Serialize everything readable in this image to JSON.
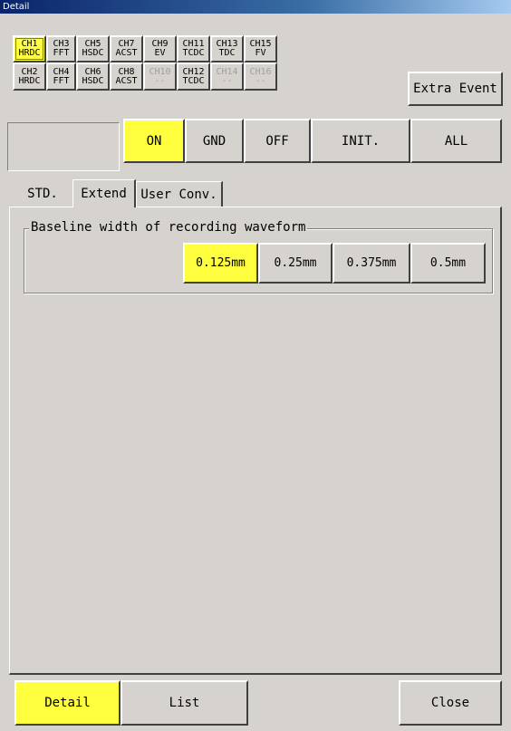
{
  "window": {
    "title": "Detail"
  },
  "channels_row1": [
    {
      "ch": "CH1",
      "type": "HRDC"
    },
    {
      "ch": "CH3",
      "type": "FFT"
    },
    {
      "ch": "CH5",
      "type": "HSDC"
    },
    {
      "ch": "CH7",
      "type": "ACST"
    },
    {
      "ch": "CH9",
      "type": "EV"
    },
    {
      "ch": "CH11",
      "type": "TCDC"
    },
    {
      "ch": "CH13",
      "type": "TDC"
    },
    {
      "ch": "CH15",
      "type": "FV"
    }
  ],
  "channels_row2": [
    {
      "ch": "CH2",
      "type": "HRDC"
    },
    {
      "ch": "CH4",
      "type": "FFT"
    },
    {
      "ch": "CH6",
      "type": "HSDC"
    },
    {
      "ch": "CH8",
      "type": "ACST"
    },
    {
      "ch": "CH10",
      "type": "--"
    },
    {
      "ch": "CH12",
      "type": "TCDC"
    },
    {
      "ch": "CH14",
      "type": "--"
    },
    {
      "ch": "CH16",
      "type": "--"
    }
  ],
  "extra_event_label": "Extra Event",
  "mode_buttons": {
    "on": "ON",
    "gnd": "GND",
    "off": "OFF",
    "init": "INIT.",
    "all": "ALL"
  },
  "tabs": {
    "std": "STD.",
    "extend": "Extend",
    "user_conv": "User Conv."
  },
  "baseline": {
    "legend": "Baseline width of recording waveform",
    "options": [
      "0.125mm",
      "0.25mm",
      "0.375mm",
      "0.5mm"
    ],
    "selected": "0.125mm"
  },
  "footer": {
    "detail": "Detail",
    "list": "List",
    "close": "Close"
  },
  "colors": {
    "selected": "#ffff40",
    "background": "#d6d3ce"
  }
}
